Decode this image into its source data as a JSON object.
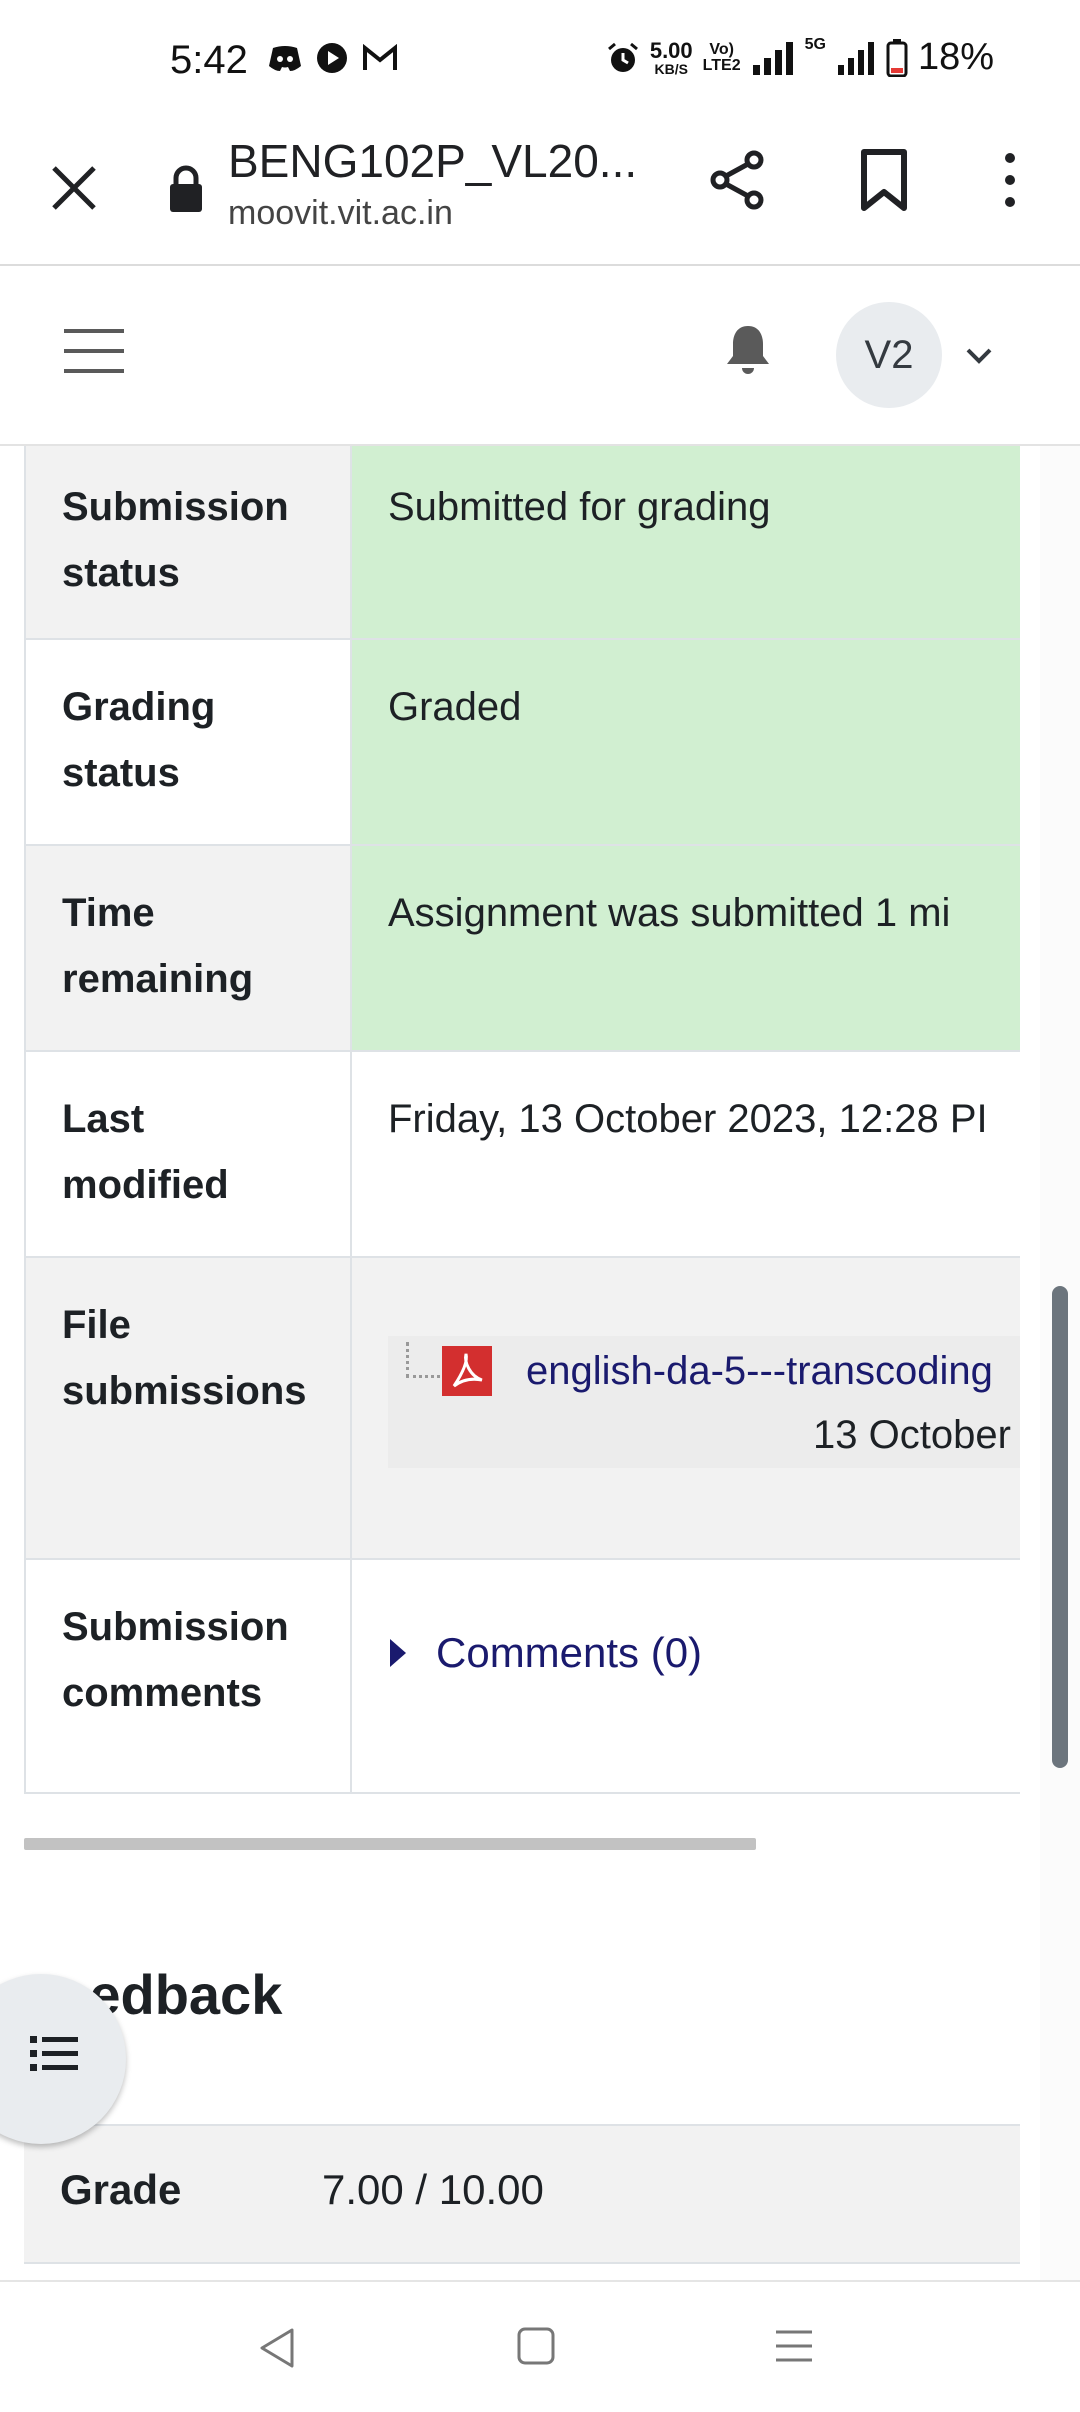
{
  "status_bar": {
    "time": "5:42",
    "net_speed_value": "5.00",
    "net_speed_unit": "KB/S",
    "volte_top": "Vo)",
    "volte_bottom": "LTE2",
    "network_5g": "5G",
    "battery": "18%"
  },
  "browser": {
    "title": "BENG102P_VL20...",
    "host": "moovit.vit.ac.in"
  },
  "navbar": {
    "avatar_initials": "V2"
  },
  "submission_table": {
    "rows": [
      {
        "label": "Submission status",
        "value": "Submitted for grading"
      },
      {
        "label": "Grading status",
        "value": "Graded"
      },
      {
        "label": "Time remaining",
        "value": "Assignment was submitted 1 mi"
      },
      {
        "label": "Last modified",
        "value": "Friday, 13 October 2023, 12:28 PI"
      },
      {
        "label": "File submissions",
        "file_name": "english-da-5---transcoding",
        "file_date": "13 October"
      },
      {
        "label": "Submission comments",
        "comments": "Comments (0)"
      }
    ]
  },
  "feedback": {
    "heading": "Feedback",
    "grade_label": "Grade",
    "grade_value": "7.00 / 10.00"
  },
  "colors": {
    "success_bg": "#d1efd1",
    "link": "#1a1a6e",
    "scroll_thumb": "#6c757d"
  }
}
